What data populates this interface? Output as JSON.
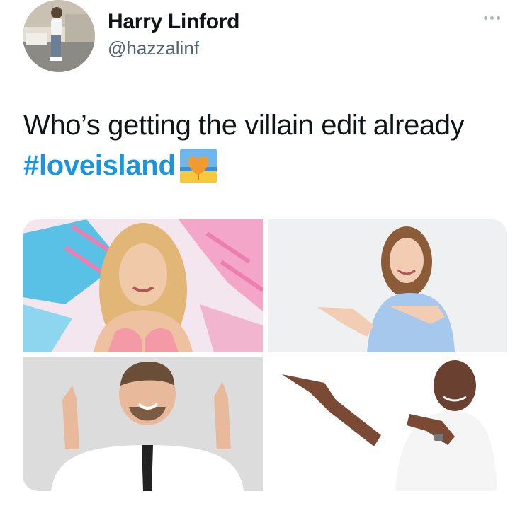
{
  "tweet": {
    "author_name": "Harry Linford",
    "author_handle": "@hazzalinf",
    "text": "Who’s getting the villain edit already",
    "hashtag": "#loveisland"
  },
  "icons": {
    "more": "more-dots-icon",
    "emoji": "love-island-heart-emoji-icon"
  },
  "colors": {
    "hashtag": "#1b95e0",
    "handle": "#536471"
  },
  "media": [
    "love-island-contestant-photo",
    "stock-photo-woman-pointing",
    "stock-photo-man-pointing-up",
    "stock-photo-man-pointing-left"
  ]
}
